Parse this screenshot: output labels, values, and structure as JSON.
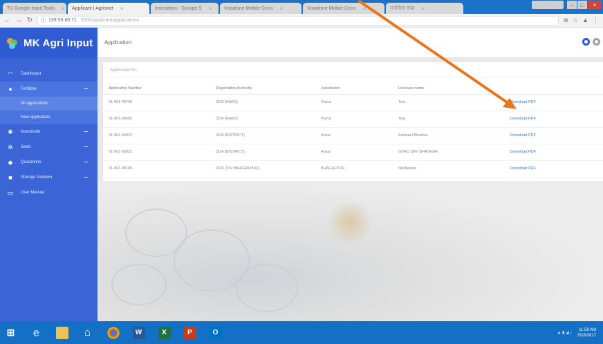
{
  "browser": {
    "tabs": [
      {
        "label": "TV Google Input Tools",
        "active": false
      },
      {
        "label": "Applicant | Agrisnet",
        "active": true
      },
      {
        "label": "translation - Google S",
        "active": false
      },
      {
        "label": "Vodafone Mobile Conn",
        "active": false
      },
      {
        "label": "Vodafone Mobile Conn",
        "active": false
      },
      {
        "label": "সর্বাধিক জমা",
        "active": false
      }
    ],
    "url_host": "139.59.80.71",
    "url_path": ":3000/applicant/applications"
  },
  "sidebar": {
    "brand": "MK Agri Input",
    "items": [
      {
        "label": "Dashboard",
        "icon": "speedometer-icon",
        "expandable": false
      },
      {
        "label": "Fertilizer",
        "icon": "user-icon",
        "expandable": true,
        "open": true
      },
      {
        "label": "Insecticide",
        "icon": "bug-icon",
        "expandable": true
      },
      {
        "label": "Seed",
        "icon": "seed-icon",
        "expandable": true
      },
      {
        "label": "Quarantine",
        "icon": "shield-icon",
        "expandable": true
      },
      {
        "label": "Storage Godown",
        "icon": "warehouse-icon",
        "expandable": true
      },
      {
        "label": "User Manual",
        "icon": "book-icon",
        "expandable": false
      }
    ],
    "subitems": [
      {
        "label": "All applications",
        "active": true
      },
      {
        "label": "New application",
        "active": false
      }
    ]
  },
  "header": {
    "title": "Application"
  },
  "content": {
    "search_placeholder": "Application No.",
    "columns": [
      "Application Number",
      "Registration Authority",
      "Jurisdiction",
      "Licensee name",
      ""
    ],
    "rows": [
      {
        "number": "01-001-00736",
        "authority": "DDA (HARS)",
        "jurisdiction": "Patna",
        "licensee": "Test",
        "action": "Download PDF"
      },
      {
        "number": "01-001-00685",
        "authority": "DDA (HARS)",
        "jurisdiction": "Patna",
        "licensee": "Test",
        "action": "Download PDF"
      },
      {
        "number": "01-001-00422",
        "authority": "DDA (DISTRICT)",
        "jurisdiction": "Arwal",
        "licensee": "Ashwani Bhaskar",
        "action": "Download PDF"
      },
      {
        "number": "01-001-00321",
        "authority": "DDA (DISTRICT)",
        "jurisdiction": "Arwal",
        "licensee": "GURU DEV BHASKAR",
        "action": "Download PDF"
      },
      {
        "number": "01-001-00189",
        "authority": "DDA, DIV (BHAGALPUR)",
        "jurisdiction": "BHAGALPUR",
        "licensee": "Nishikanta",
        "action": "Download PDF"
      }
    ]
  },
  "taskbar": {
    "apps": [
      "start-icon",
      "ie-icon",
      "file-explorer-icon",
      "store-icon",
      "chrome-icon",
      "word-icon",
      "excel-icon",
      "powerpoint-icon",
      "outlook-icon"
    ],
    "time": "11:59 AM",
    "date": "5/18/2017"
  },
  "colors": {
    "sidebar": "#3b65d6",
    "accent": "#2a5bd7",
    "arrow": "#e8741e",
    "link": "#3c7bd8"
  }
}
